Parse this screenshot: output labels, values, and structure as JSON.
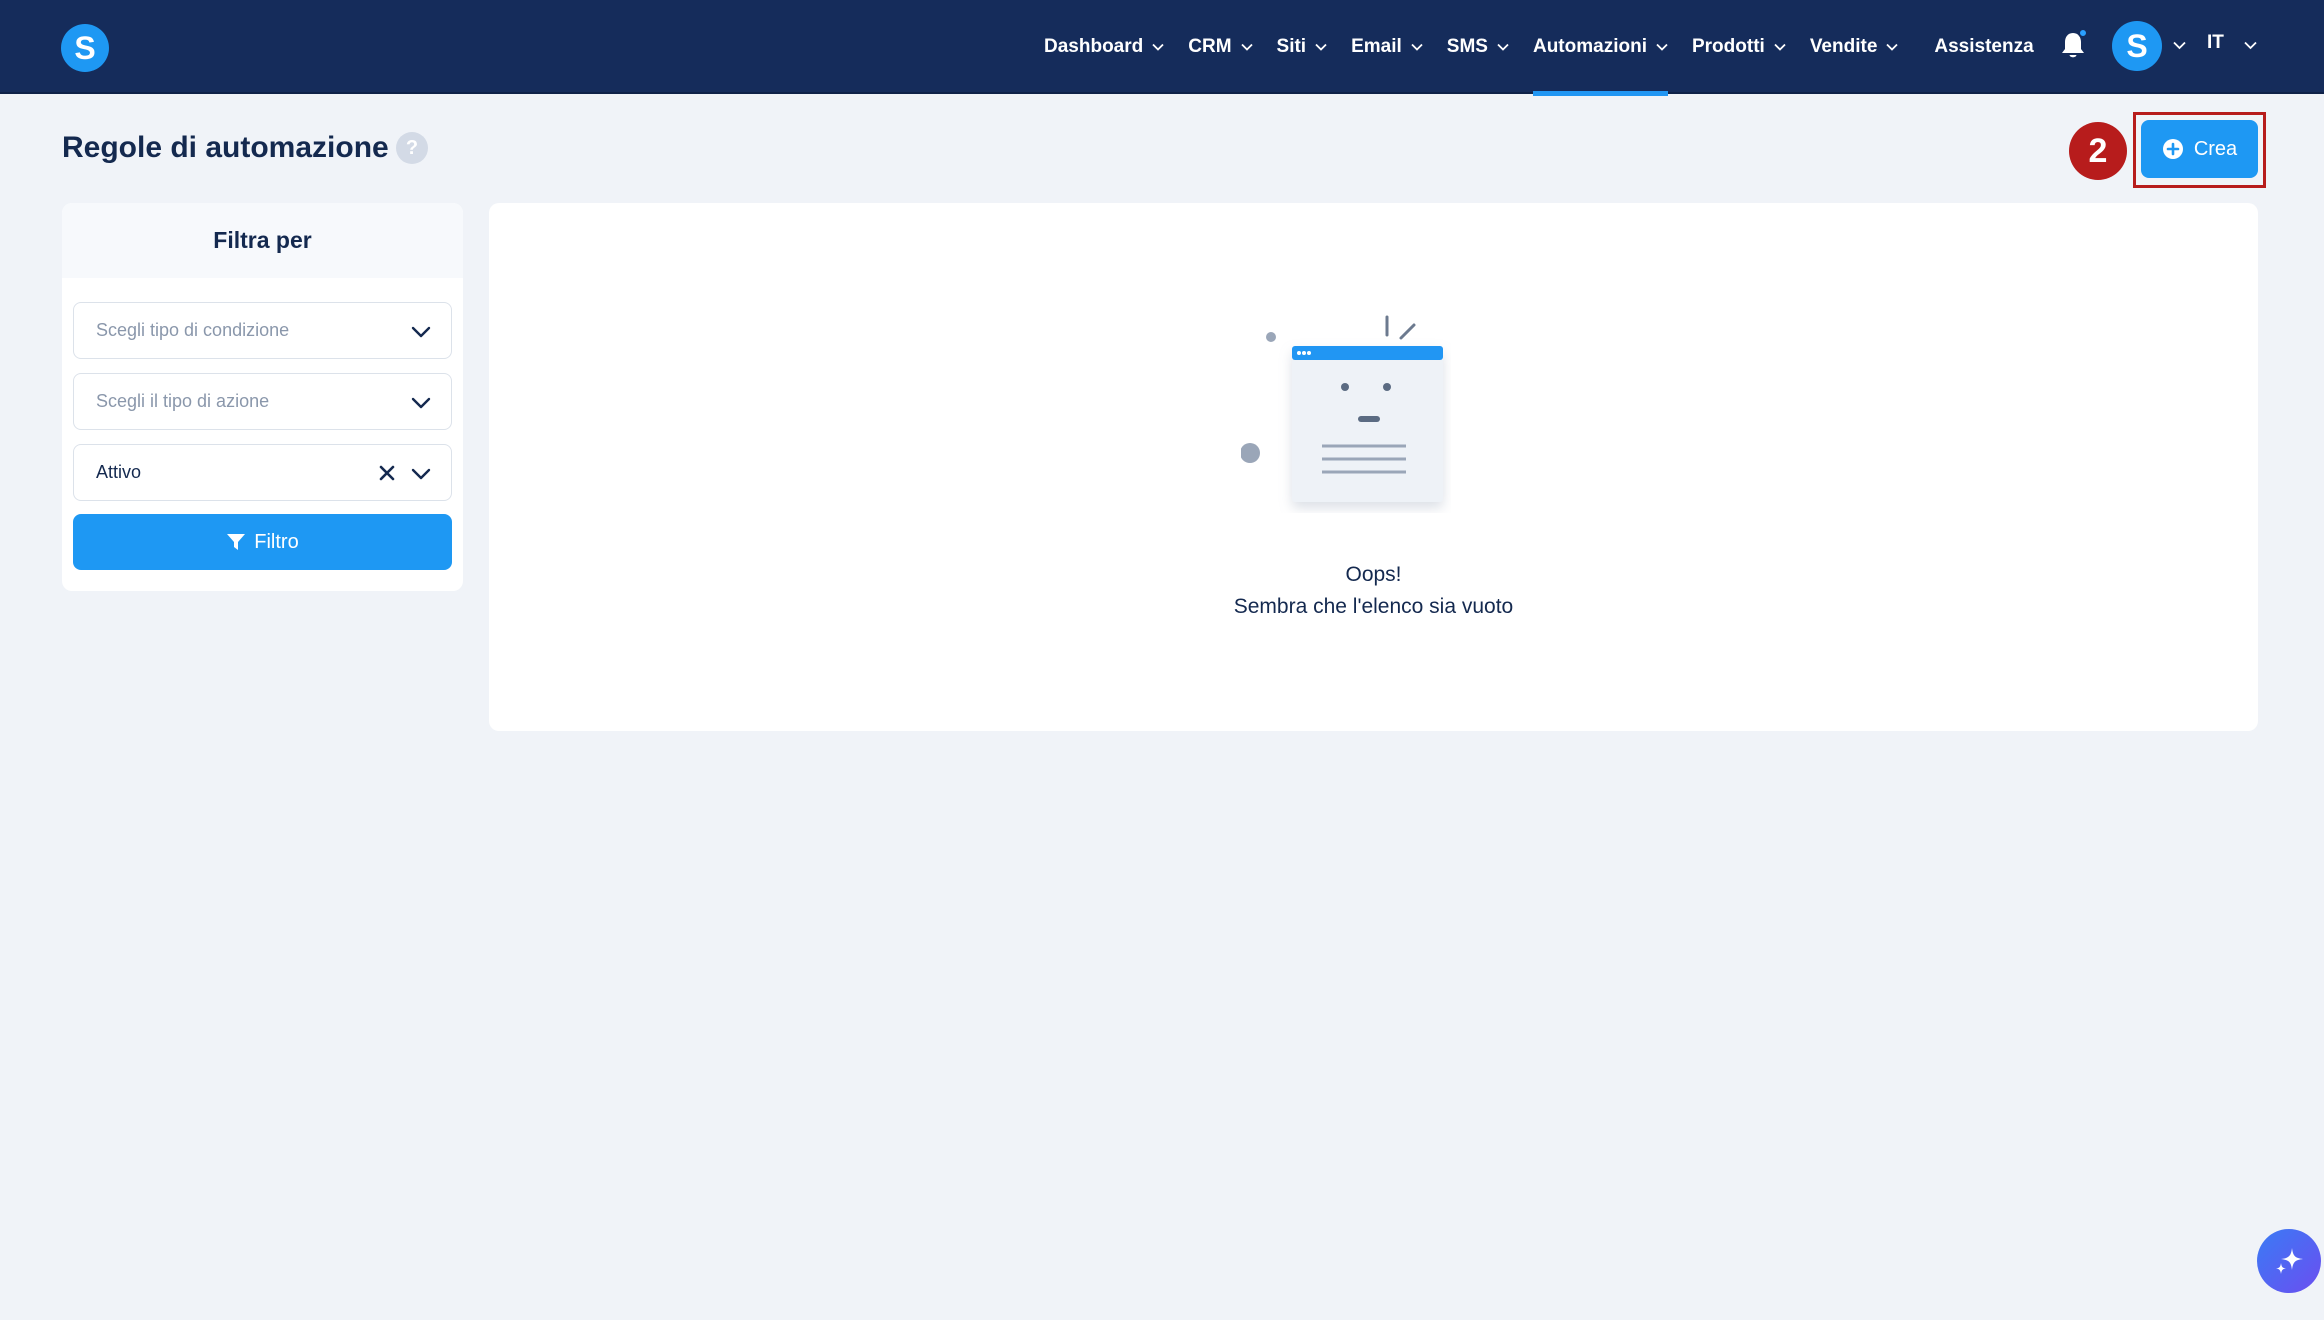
{
  "nav": {
    "items": [
      {
        "label": "Dashboard"
      },
      {
        "label": "CRM"
      },
      {
        "label": "Siti"
      },
      {
        "label": "Email"
      },
      {
        "label": "SMS"
      },
      {
        "label": "Automazioni"
      },
      {
        "label": "Prodotti"
      },
      {
        "label": "Vendite"
      }
    ],
    "active": "Automazioni",
    "help_label": "Assistenza",
    "language": "IT"
  },
  "header": {
    "title": "Regole di automazione",
    "help_glyph": "?",
    "step_badge": "2",
    "create_label": "Crea"
  },
  "filter": {
    "title": "Filtra per",
    "condition_placeholder": "Scegli tipo di condizione",
    "action_placeholder": "Scegli il tipo di azione",
    "status_value": "Attivo",
    "button_label": "Filtro"
  },
  "empty_state": {
    "title": "Oops!",
    "subtitle": "Sembra che l'elenco sia vuoto"
  },
  "colors": {
    "navbar": "#152c5b",
    "accent": "#1e98f3",
    "highlight": "#b71c1c",
    "background": "#f0f3f8"
  },
  "icons": [
    "logo-s-icon",
    "chevron-down-icon",
    "bell-icon",
    "avatar-s-icon",
    "help-icon",
    "plus-circle-icon",
    "close-icon",
    "funnel-icon",
    "empty-document-icon",
    "sparkle-icon"
  ]
}
